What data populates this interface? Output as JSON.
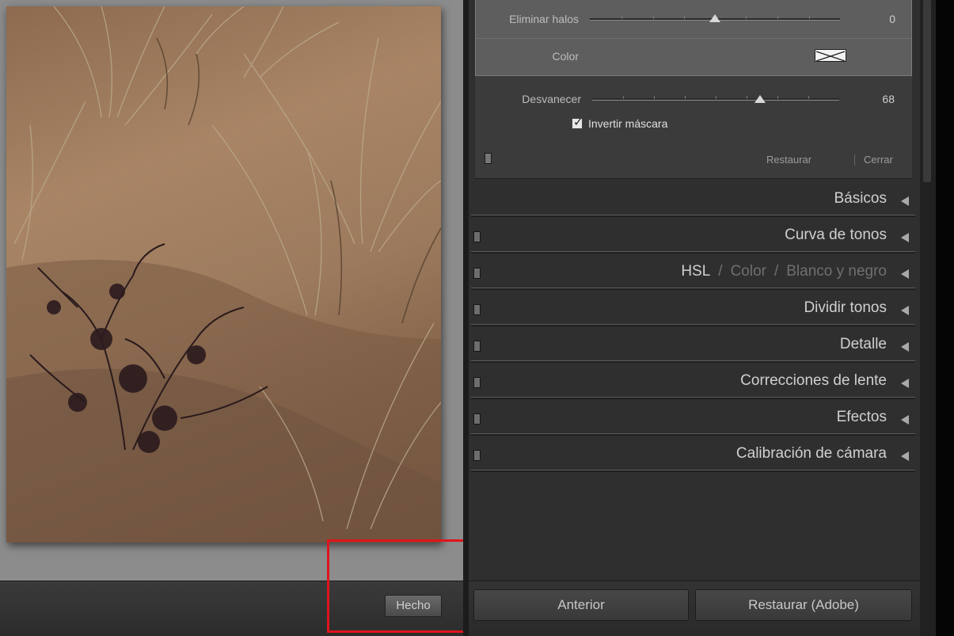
{
  "photo_panel": {
    "done_label": "Hecho"
  },
  "brush": {
    "defringe": {
      "label": "Eliminar halos",
      "value": "0",
      "level_pct": 50
    },
    "color": {
      "label": "Color"
    },
    "feather": {
      "label": "Desvanecer",
      "value": "68",
      "level_pct": 68
    },
    "invert_mask": {
      "label": "Invertir máscara",
      "checked": true
    },
    "restore_label": "Restaurar",
    "close_label": "Cerrar"
  },
  "sections": [
    {
      "title": "Básicos",
      "has_switch": false
    },
    {
      "title": "Curva de tonos",
      "has_switch": true
    },
    {
      "title_parts": [
        "HSL",
        "Color",
        "Blanco y negro"
      ],
      "separator": "/",
      "has_switch": true
    },
    {
      "title": "Dividir tonos",
      "has_switch": true
    },
    {
      "title": "Detalle",
      "has_switch": true
    },
    {
      "title": "Correcciones de lente",
      "has_switch": true
    },
    {
      "title": "Efectos",
      "has_switch": true
    },
    {
      "title": "Calibración de cámara",
      "has_switch": true
    }
  ],
  "bottom": {
    "previous_label": "Anterior",
    "reset_label": "Restaurar (Adobe)"
  },
  "colors": {
    "highlight": "#e0141b",
    "panel_bg": "#2f2f2f",
    "brush_bg": "#5e5e5e"
  }
}
